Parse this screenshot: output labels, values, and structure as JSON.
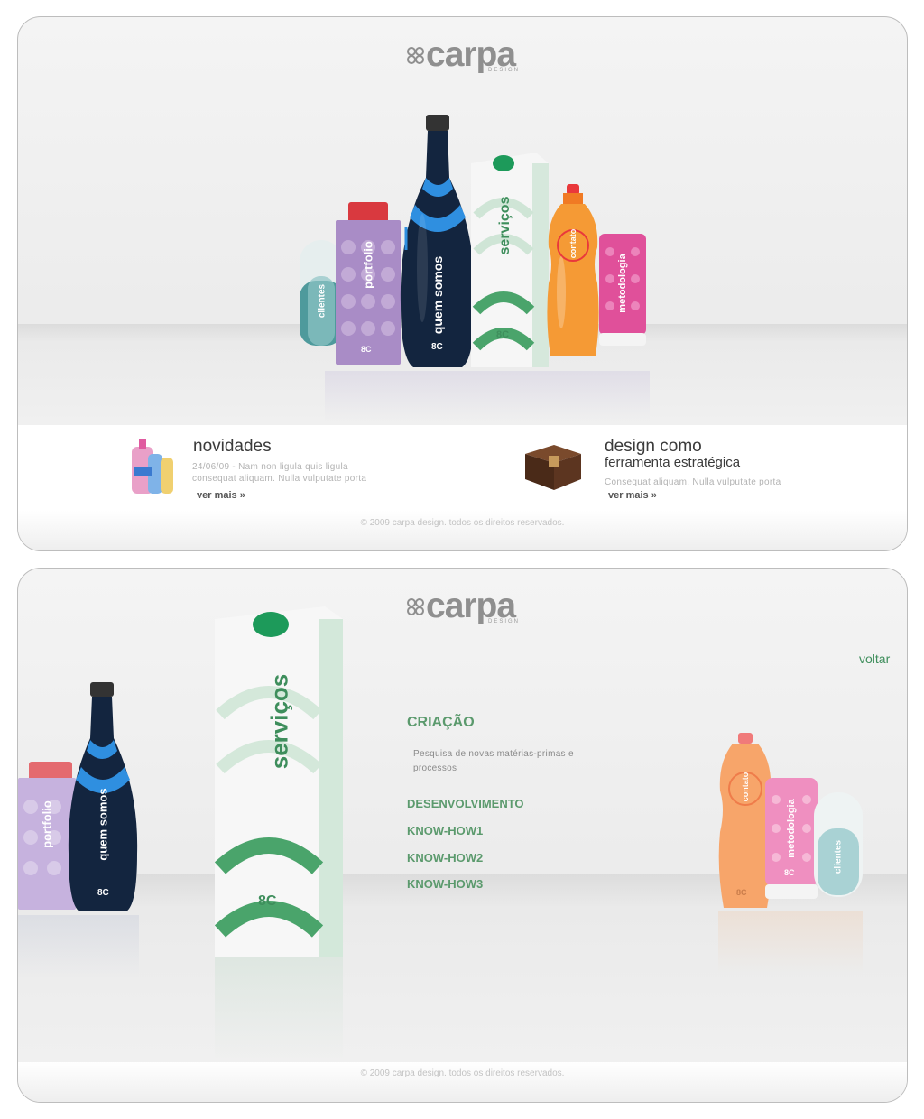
{
  "brand": {
    "name": "carpa",
    "subtitle": "DESIGN"
  },
  "colors": {
    "accent_green": "#5b9a6d",
    "text_dark": "#3a3a3a",
    "text_light": "#b3b3b3"
  },
  "products": {
    "clientes": "clientes",
    "portfolio": "portfolio",
    "quem_somos": "quem somos",
    "servicos": "serviços",
    "contato": "contato",
    "metodologia": "metodologia",
    "mark": "8C"
  },
  "home": {
    "news": {
      "title": "novidades",
      "text_line1": "24/06/09 - Nam non ligula quis ligula",
      "text_line2": "consequat aliquam. Nulla vulputate porta",
      "more": "ver mais »"
    },
    "feature": {
      "title": "design como",
      "subtitle": "ferramenta estratégica",
      "text": "Consequat aliquam. Nulla vulputate porta",
      "more": "ver mais »"
    },
    "copyright": "© 2009 carpa design. todos os direitos reservados."
  },
  "services": {
    "back": "voltar",
    "heading": "CRIAÇÃO",
    "desc_line1": "Pesquisa de novas matérias-primas e",
    "desc_line2": "processos",
    "menu": [
      "DESENVOLVIMENTO",
      "KNOW-HOW1",
      "KNOW-HOW2",
      "KNOW-HOW3"
    ],
    "copyright": "© 2009 carpa design. todos os direitos reservados."
  }
}
